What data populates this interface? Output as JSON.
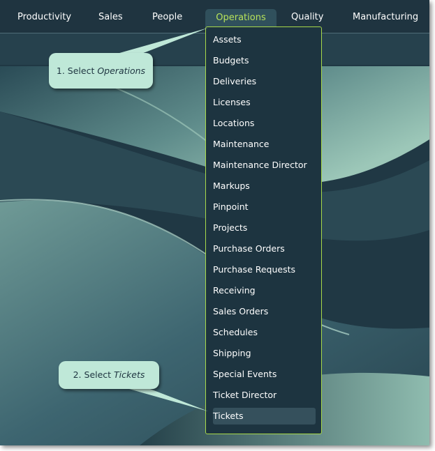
{
  "nav": {
    "items": [
      "Productivity",
      "Sales",
      "People",
      "Operations",
      "Quality",
      "Manufacturing"
    ],
    "active": "Operations"
  },
  "dropdown": {
    "items": [
      "Assets",
      "Budgets",
      "Deliveries",
      "Licenses",
      "Locations",
      "Maintenance",
      "Maintenance Director",
      "Markups",
      "Pinpoint",
      "Projects",
      "Purchase Orders",
      "Purchase Requests",
      "Receiving",
      "Sales Orders",
      "Schedules",
      "Shipping",
      "Special Events",
      "Ticket Director",
      "Tickets"
    ],
    "selected": "Tickets"
  },
  "callouts": {
    "step1": {
      "prefix": "1. Select ",
      "emphasis": "Operations"
    },
    "step2": {
      "prefix": "2. Select ",
      "emphasis": "Tickets"
    }
  },
  "colors": {
    "background": "#1d3541",
    "active_nav_text": "#b7e35a",
    "dropdown_border": "#a8d94a",
    "callout": "#bfe8d8"
  }
}
